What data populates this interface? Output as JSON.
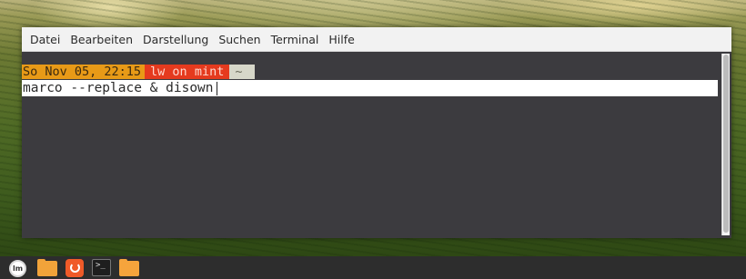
{
  "menubar": {
    "items": [
      "Datei",
      "Bearbeiten",
      "Darstellung",
      "Suchen",
      "Terminal",
      "Hilfe"
    ]
  },
  "prompt": {
    "date": "So Nov 05, 22:15",
    "user": "lw on mint",
    "dir": "~"
  },
  "command": {
    "text": "marco --replace & disown"
  },
  "taskbar": {
    "items": [
      "menu-icon",
      "folder-icon",
      "backup-icon",
      "terminal-icon",
      "files-icon"
    ],
    "menu_label": "lm",
    "terminal_glyph": ">_"
  },
  "colors": {
    "prompt_date_bg": "#e89a17",
    "prompt_user_bg": "#e53a1e",
    "prompt_dir_bg": "#d7d7c9",
    "terminal_bg": "#3c3b3f",
    "taskbar_bg": "#2d2d2d"
  }
}
